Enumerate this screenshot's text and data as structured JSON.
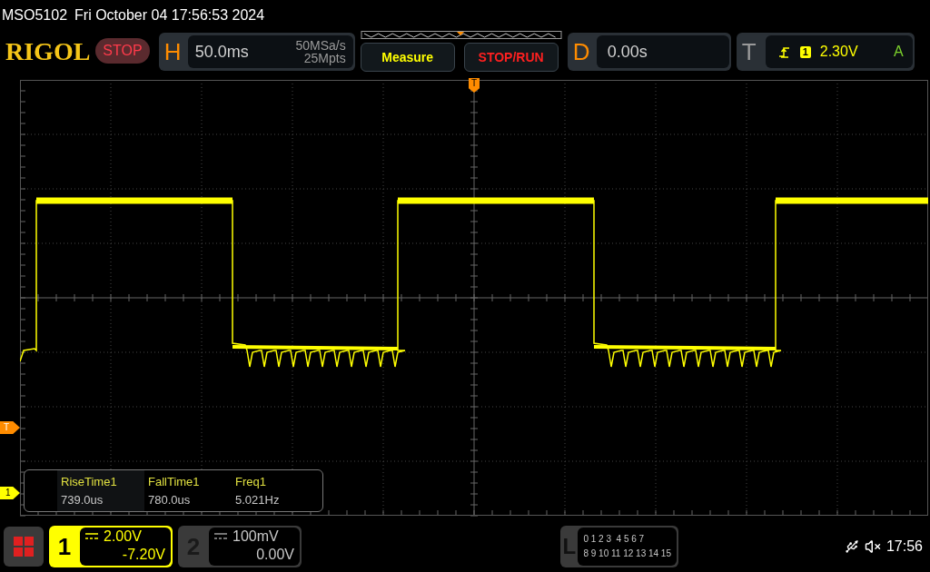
{
  "status_line": {
    "model": "MSO5102",
    "datetime": "Fri October 04 17:56:53 2024"
  },
  "header": {
    "logo": "RIGOL",
    "run_state": {
      "label": "STOP",
      "kind": "stop"
    },
    "horizontal": {
      "key": "H",
      "timebase": "50.0ms",
      "sample_rate": "50MSa/s",
      "memory_depth": "25Mpts"
    },
    "buttons": [
      {
        "label": "Measure",
        "kind": "measure"
      },
      {
        "label": "STOP/RUN",
        "kind": "stoprun"
      }
    ],
    "delay": {
      "key": "D",
      "value": "0.00s"
    },
    "trigger": {
      "key": "T",
      "source": "1",
      "level": "2.30V",
      "mode": "A"
    }
  },
  "display": {
    "trigger_marker": "T",
    "trigger_level_marker": "T",
    "channel_marker": "1",
    "measurements": [
      {
        "name": "RiseTime1",
        "value": "739.0us"
      },
      {
        "name": "FallTime1",
        "value": "780.0us"
      },
      {
        "name": "Freq1",
        "value": "5.021Hz"
      }
    ]
  },
  "channels": [
    {
      "number": "1",
      "scale": "2.00V",
      "offset": "-7.20V",
      "selected": true
    },
    {
      "number": "2",
      "scale": "100mV",
      "offset": "0.00V",
      "selected": false
    }
  ],
  "logic": {
    "key": "L",
    "row_1": "0 1 2 3  4 5 6 7",
    "row_2": "8 9 10 11 12 13 14 15"
  },
  "status_bar": {
    "time": "17:56"
  }
}
